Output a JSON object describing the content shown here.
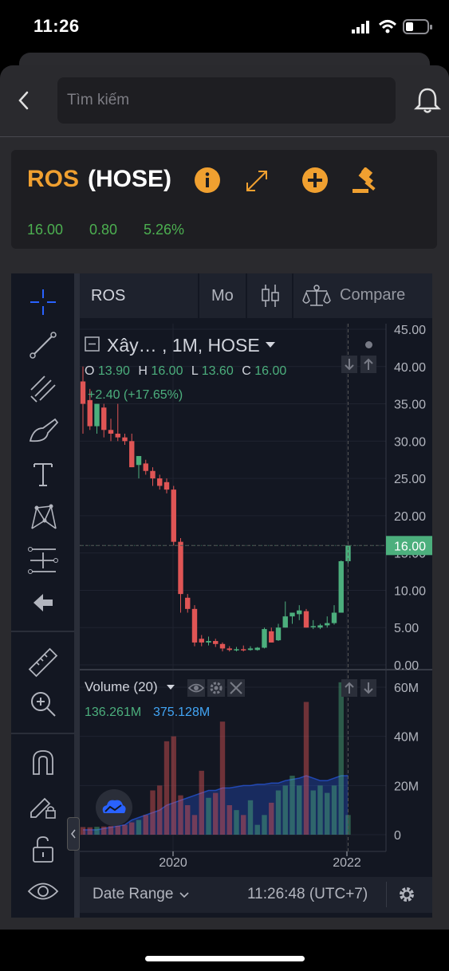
{
  "status_bar": {
    "time": "11:26"
  },
  "search": {
    "placeholder": "Tìm kiếm"
  },
  "quote": {
    "symbol": "ROS",
    "exchange": "(HOSE)",
    "price": "16.00",
    "change": "0.80",
    "percent": "5.26%"
  },
  "toolbar": {
    "symbol": "ROS",
    "interval": "Mo",
    "compare": "Compare"
  },
  "legend": {
    "name": "Xây… , 1M, HOSE",
    "open_label": "O",
    "open": "13.90",
    "high_label": "H",
    "high": "16.00",
    "low_label": "L",
    "low": "13.60",
    "close_label": "C",
    "close": "16.00",
    "change": "+2.40 (+17.65%)"
  },
  "volume_legend": {
    "title": "Volume (20)",
    "vol": "136.261M",
    "ma": "375.128M"
  },
  "price_axis": [
    "45.00",
    "40.00",
    "35.00",
    "30.00",
    "25.00",
    "20.00",
    "15.00",
    "10.00",
    "5.00",
    "0.00"
  ],
  "current_price_label": "16.00",
  "volume_axis": [
    "60M",
    "40M",
    "20M",
    "0"
  ],
  "time_axis": [
    "2020",
    "2022"
  ],
  "footer": {
    "date_range": "Date Range",
    "clock": "11:26:48 (UTC+7)"
  },
  "colors": {
    "up": "#4caf7d",
    "down": "#e05555",
    "accent": "#f0a030",
    "price_tag": "#4caf7d"
  },
  "chart_data": {
    "type": "candlestick",
    "candles": [
      {
        "o": 38.0,
        "h": 40.0,
        "c": 35.0,
        "l": 31.0
      },
      {
        "o": 35.5,
        "h": 37.0,
        "c": 32.0,
        "l": 31.5
      },
      {
        "o": 32.0,
        "h": 35.0,
        "c": 35.0,
        "l": 31.0
      },
      {
        "o": 34.5,
        "h": 35.0,
        "c": 31.5,
        "l": 30.5
      },
      {
        "o": 31.5,
        "h": 33.0,
        "c": 31.0,
        "l": 30.0
      },
      {
        "o": 31.0,
        "h": 35.0,
        "c": 30.5,
        "l": 30.0
      },
      {
        "o": 30.5,
        "h": 31.0,
        "c": 30.0,
        "l": 29.5
      },
      {
        "o": 30.0,
        "h": 31.0,
        "c": 26.5,
        "l": 26.5
      },
      {
        "o": 26.8,
        "h": 28.0,
        "c": 28.0,
        "l": 25.0
      },
      {
        "o": 27.0,
        "h": 27.5,
        "c": 26.0,
        "l": 25.5
      },
      {
        "o": 26.0,
        "h": 26.5,
        "c": 25.0,
        "l": 24.0
      },
      {
        "o": 25.0,
        "h": 25.5,
        "c": 24.0,
        "l": 23.5
      },
      {
        "o": 24.5,
        "h": 25.0,
        "c": 23.5,
        "l": 23.0
      },
      {
        "o": 23.5,
        "h": 24.0,
        "c": 16.5,
        "l": 16.0
      },
      {
        "o": 16.5,
        "h": 17.0,
        "c": 9.5,
        "l": 7.0
      },
      {
        "o": 9.0,
        "h": 9.5,
        "c": 7.5,
        "l": 7.0
      },
      {
        "o": 7.5,
        "h": 8.0,
        "c": 3.0,
        "l": 2.5
      },
      {
        "o": 3.5,
        "h": 4.0,
        "c": 3.0,
        "l": 2.5
      },
      {
        "o": 3.0,
        "h": 3.8,
        "c": 3.2,
        "l": 2.6
      },
      {
        "o": 3.2,
        "h": 3.5,
        "c": 2.8,
        "l": 2.4
      },
      {
        "o": 2.8,
        "h": 3.0,
        "c": 2.2,
        "l": 1.8
      },
      {
        "o": 2.2,
        "h": 2.5,
        "c": 2.0,
        "l": 1.8
      },
      {
        "o": 2.0,
        "h": 2.4,
        "c": 2.1,
        "l": 1.8
      },
      {
        "o": 2.1,
        "h": 2.6,
        "c": 2.0,
        "l": 1.8
      },
      {
        "o": 2.0,
        "h": 2.5,
        "c": 2.2,
        "l": 1.9
      },
      {
        "o": 2.0,
        "h": 2.4,
        "c": 2.3,
        "l": 1.9
      },
      {
        "o": 2.3,
        "h": 5.0,
        "c": 4.8,
        "l": 2.2
      },
      {
        "o": 4.5,
        "h": 5.0,
        "c": 3.0,
        "l": 3.0
      },
      {
        "o": 3.3,
        "h": 5.5,
        "c": 5.0,
        "l": 3.2
      },
      {
        "o": 5.0,
        "h": 8.5,
        "c": 6.5,
        "l": 5.0
      },
      {
        "o": 6.5,
        "h": 7.0,
        "c": 7.0,
        "l": 5.5
      },
      {
        "o": 6.8,
        "h": 8.0,
        "c": 7.3,
        "l": 6.0
      },
      {
        "o": 7.2,
        "h": 7.5,
        "c": 5.0,
        "l": 5.0
      },
      {
        "o": 5.2,
        "h": 6.0,
        "c": 5.2,
        "l": 4.8
      },
      {
        "o": 5.0,
        "h": 5.5,
        "c": 5.3,
        "l": 4.8
      },
      {
        "o": 5.3,
        "h": 6.5,
        "c": 5.6,
        "l": 5.0
      },
      {
        "o": 5.6,
        "h": 8.0,
        "c": 7.0,
        "l": 5.4
      },
      {
        "o": 7.0,
        "h": 14.0,
        "c": 13.9,
        "l": 7.0
      },
      {
        "o": 13.9,
        "h": 16.0,
        "c": 16.0,
        "l": 13.6
      }
    ],
    "volumes_m": [
      3.1,
      3.0,
      3.2,
      3.3,
      3.5,
      3.6,
      4.0,
      5.0,
      6.0,
      8.0,
      18,
      20,
      38,
      40,
      16,
      12,
      8,
      26,
      15,
      17,
      46,
      12,
      10,
      8,
      14,
      4,
      8,
      13,
      18,
      20,
      24,
      20,
      54,
      18,
      20,
      17,
      20,
      62,
      8
    ],
    "volume_ma_m": [
      2,
      2,
      2,
      2.5,
      3,
      3.5,
      4,
      6,
      7,
      8,
      9,
      10,
      12,
      13,
      14,
      15,
      16,
      17,
      18,
      18,
      19,
      19,
      19.5,
      20,
      20,
      20.5,
      20.5,
      21,
      21,
      22,
      22.5,
      23,
      24,
      23,
      22,
      22,
      23,
      24,
      24
    ],
    "ylim_price": [
      0,
      45
    ],
    "ylim_volume": [
      0,
      60
    ]
  }
}
